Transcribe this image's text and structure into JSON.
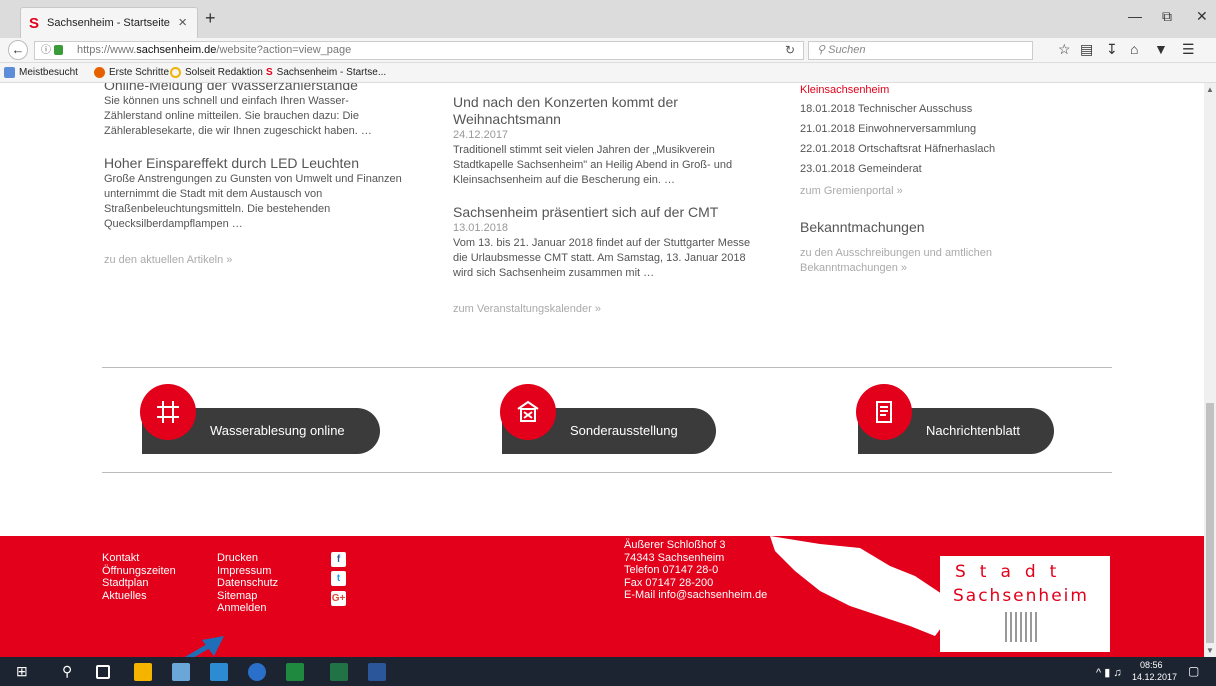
{
  "browser": {
    "tab_title": "Sachsenheim - Startseite",
    "new_tab": "+",
    "tab_close": "×",
    "url_prefix": "https://www.",
    "url_domain": "sachsenheim.de",
    "url_path": "/website?action=view_page",
    "search_placeholder": "Suchen",
    "bookmarks": [
      "Meistbesucht",
      "Erste Schritte",
      "Solseit Redaktion",
      "Sachsenheim - Startse..."
    ]
  },
  "left_col": {
    "item1_title": "Online-Meldung der Wasserzählerstände",
    "item1_text": "Sie können uns schnell und einfach Ihren Wasser-Zählerstand online mitteilen. Sie brauchen dazu: Die Zählerablesekarte, die wir Ihnen zugeschickt haben. …",
    "item2_title": "Hoher Einspareffekt durch LED Leuchten",
    "item2_text": "Große Anstrengungen zu Gunsten von Umwelt und Finanzen unternimmt die Stadt mit dem Austausch von Straßenbeleuchtungsmitteln. Die bestehenden Quecksilberdampflampen …",
    "more": "zu den aktuellen Artikeln »"
  },
  "mid_col": {
    "item1_title": "Und nach den Konzerten kommt der Weihnachtsmann",
    "item1_date": "24.12.2017",
    "item1_text": "Traditionell stimmt seit vielen Jahren der „Musikverein Stadtkapelle Sachsenheim\" an Heilig Abend in Groß- und Kleinsachsenheim auf die Bescherung ein. …",
    "item2_title": "Sachsenheim präsentiert sich auf der CMT",
    "item2_date": "13.01.2018",
    "item2_text": "Vom 13. bis 21. Januar 2018 findet auf der Stuttgarter Messe die Urlaubsmesse CMT statt. Am Samstag, 13. Januar 2018 wird sich Sachsenheim zusammen mit …",
    "more": "zum Veranstaltungskalender »"
  },
  "right_col": {
    "red_heading": "Kleinsachsenheim",
    "meetings": [
      "18.01.2018 Technischer Ausschuss",
      "21.01.2018 Einwohnerversammlung",
      "22.01.2018 Ortschaftsrat Häfnerhaslach",
      "23.01.2018 Gemeinderat"
    ],
    "portal_link": "zum Gremienportal »",
    "bekannt_title": "Bekanntmachungen",
    "bekannt_link": "zu den Ausschreibungen und amtlichen Bekanntmachungen »"
  },
  "buttons": {
    "wasser": "Wasserablesung online",
    "sonder": "Sonderausstellung",
    "nachrichten": "Nachrichtenblatt"
  },
  "footer": {
    "col1": [
      "Kontakt",
      "Öffnungszeiten",
      "Stadtplan",
      "Aktuelles"
    ],
    "col2": [
      "Drucken",
      "Impressum",
      "Datenschutz",
      "Sitemap",
      "Anmelden"
    ],
    "address": [
      "Äußerer Schloßhof 3",
      "74343 Sachsenheim",
      "Telefon 07147 28-0",
      "Fax 07147 28-200",
      "E-Mail info@sachsenheim.de"
    ],
    "logo_line1": "Stadt",
    "logo_line2": "Sachsenheim",
    "social_fb": "f",
    "social_tw": "t",
    "social_gp": "G+"
  },
  "taskbar": {
    "time": "08:56",
    "date": "14.12.2017"
  },
  "colors": {
    "brand_red": "#e2001a",
    "dark_pill": "#3b3b3b"
  }
}
